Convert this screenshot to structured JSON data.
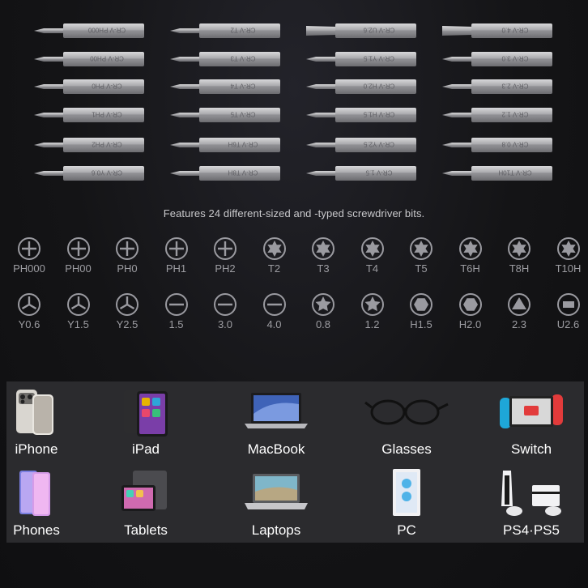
{
  "bits_grid": {
    "columns": [
      [
        "CR-V PH000",
        "CR-V PH00",
        "CR-V PH0",
        "CR-V PH1",
        "CR-V PH2",
        "CR-V Y0.6"
      ],
      [
        "CR-V T2",
        "CR-V T3",
        "CR-V T4",
        "CR-V T5",
        "CR-V T6H",
        "CR-V T8H"
      ],
      [
        "CR-V U2.6",
        "CR-V Y1.5",
        "CR-V H2.0",
        "CR-V H1.5",
        "CR-V Y2.5",
        "CR-V 1.5"
      ],
      [
        "CR-V 4.0",
        "CR-V 3.0",
        "CR-V 2.3",
        "CR-V 1.2",
        "CR-V 0.8",
        "CR-V T10H"
      ]
    ]
  },
  "tagline": "Features 24 different-sized and -typed screwdriver bits.",
  "bit_types": {
    "row1": [
      {
        "label": "PH000",
        "icon": "phillips-icon"
      },
      {
        "label": "PH00",
        "icon": "phillips-icon"
      },
      {
        "label": "PH0",
        "icon": "phillips-icon"
      },
      {
        "label": "PH1",
        "icon": "phillips-icon"
      },
      {
        "label": "PH2",
        "icon": "phillips-icon"
      },
      {
        "label": "T2",
        "icon": "torx-icon"
      },
      {
        "label": "T3",
        "icon": "torx-icon"
      },
      {
        "label": "T4",
        "icon": "torx-icon"
      },
      {
        "label": "T5",
        "icon": "torx-icon"
      },
      {
        "label": "T6H",
        "icon": "torx-icon"
      },
      {
        "label": "T8H",
        "icon": "torx-icon"
      },
      {
        "label": "T10H",
        "icon": "torx-icon"
      }
    ],
    "row2": [
      {
        "label": "Y0.6",
        "icon": "tri-wing-icon"
      },
      {
        "label": "Y1.5",
        "icon": "tri-wing-icon"
      },
      {
        "label": "Y2.5",
        "icon": "tri-wing-icon"
      },
      {
        "label": "1.5",
        "icon": "slotted-icon"
      },
      {
        "label": "3.0",
        "icon": "slotted-icon"
      },
      {
        "label": "4.0",
        "icon": "slotted-icon"
      },
      {
        "label": "0.8",
        "icon": "pentalobe-icon"
      },
      {
        "label": "1.2",
        "icon": "pentalobe-icon"
      },
      {
        "label": "H1.5",
        "icon": "hex-icon"
      },
      {
        "label": "H2.0",
        "icon": "hex-icon"
      },
      {
        "label": "2.3",
        "icon": "triangle-icon"
      },
      {
        "label": "U2.6",
        "icon": "u-shape-icon"
      }
    ]
  },
  "devices": [
    {
      "label": "iPhone",
      "icon": "iphone-icon"
    },
    {
      "label": "iPad",
      "icon": "ipad-icon"
    },
    {
      "label": "MacBook",
      "icon": "macbook-icon"
    },
    {
      "label": "Glasses",
      "icon": "glasses-icon"
    },
    {
      "label": "Switch",
      "icon": "switch-icon"
    },
    {
      "label": "Phones",
      "icon": "phones-icon"
    },
    {
      "label": "Tablets",
      "icon": "tablets-icon"
    },
    {
      "label": "Laptops",
      "icon": "laptops-icon"
    },
    {
      "label": "PC",
      "icon": "pc-icon"
    },
    {
      "label": "PS4·PS5",
      "icon": "playstation-icon"
    }
  ],
  "colors": {
    "background": "#141416",
    "panel": "#2b2b2e",
    "bit_metal": "#b9b9bb",
    "icon_ring": "#9a9aa0"
  }
}
